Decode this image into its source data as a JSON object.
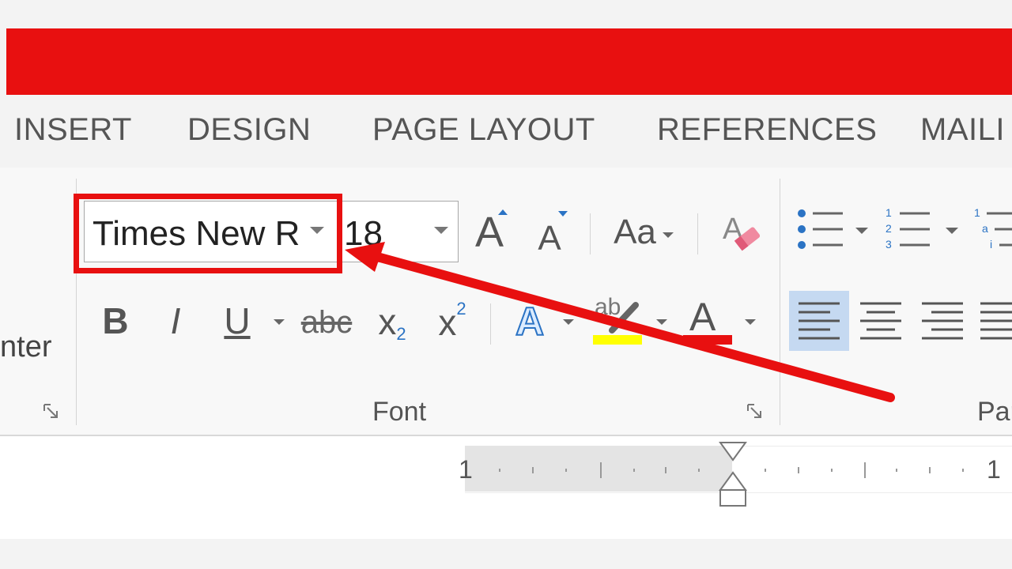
{
  "tabs": [
    {
      "label": "INSERT"
    },
    {
      "label": "DESIGN"
    },
    {
      "label": "PAGE LAYOUT"
    },
    {
      "label": "REFERENCES"
    },
    {
      "label": "MAILI"
    }
  ],
  "clipboard": {
    "partial_label": "nter"
  },
  "font_group": {
    "label": "Font",
    "font_name": "Times New R",
    "font_size": "18",
    "change_case_label": "Aa",
    "bold_label": "B",
    "italic_label": "I",
    "underline_label": "U",
    "strikethrough_label": "abc",
    "subscript_label": "x",
    "subscript_mark": "2",
    "superscript_label": "x",
    "superscript_mark": "2",
    "text_effects_label": "A",
    "highlight_label": "ab",
    "font_color_label": "A",
    "grow_label": "A",
    "shrink_label": "A"
  },
  "paragraph_group": {
    "partial_label": "Par"
  },
  "ruler": {
    "left_mark": "1",
    "right_mark": "1"
  },
  "colors": {
    "titlebar": "#e81010",
    "annotation": "#e81010",
    "highlight_yellow": "#ffff00",
    "font_color_red": "#e81010",
    "selected_blue": "#c5d9f1",
    "accent_blue": "#2b73c4"
  }
}
